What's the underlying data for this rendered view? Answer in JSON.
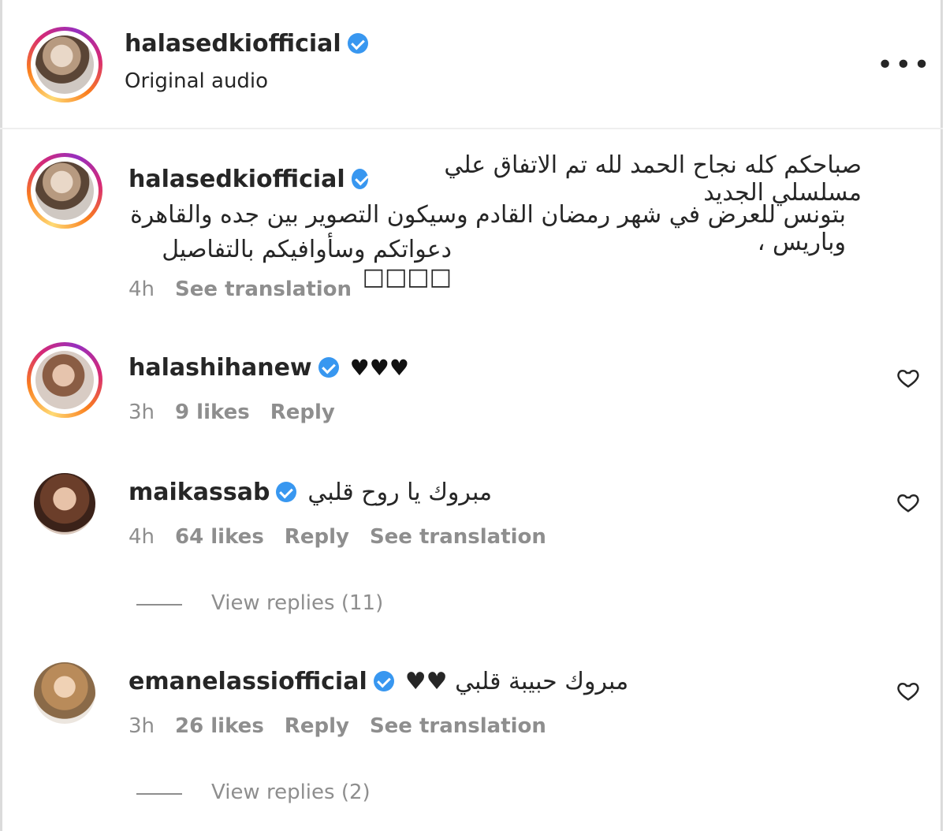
{
  "header": {
    "username": "halasedkiofficial",
    "subtitle": "Original audio",
    "more_icon": "more-horizontal-icon"
  },
  "caption": {
    "username": "halasedkiofficial",
    "line1": "صباحكم كله نجاح الحمد لله تم الاتفاق علي مسلسلي الجديد",
    "line2": "بتونس للعرض في شهر رمضان القادم وسيكون التصوير بين جده والقاهرة وباريس ،",
    "line3": "دعواتكم وسأوافيكم بالتفاصيل □□□□",
    "time": "4h",
    "see_translation": "See translation"
  },
  "comments": [
    {
      "username": "halashihanew",
      "text": "♥♥♥",
      "time": "3h",
      "likes": "9 likes",
      "reply": "Reply"
    },
    {
      "username": "maikassab",
      "text": "مبروك يا روح قلبي",
      "time": "4h",
      "likes": "64 likes",
      "reply": "Reply",
      "see_translation": "See translation",
      "view_replies": "View replies (11)"
    },
    {
      "username": "emanelassiofficial",
      "text": "مبروك حبيبة قلبي ♥♥",
      "time": "3h",
      "likes": "26 likes",
      "reply": "Reply",
      "see_translation": "See translation",
      "view_replies": "View replies (2)"
    }
  ]
}
